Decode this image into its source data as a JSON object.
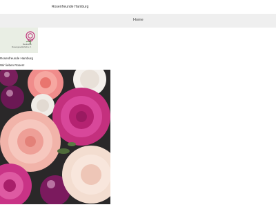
{
  "header": {
    "site_title": "Rosenfreunde Hamburg"
  },
  "nav": {
    "items": [
      {
        "label": "Home"
      }
    ]
  },
  "sidebar": {
    "logo_text_line1": "Deutsche",
    "logo_text_line2": "Rosengesellschaft e.V.",
    "name": "Rosenfreunde Hamburg",
    "tagline": "Wir lieben Rosen!"
  },
  "colors": {
    "nav_background": "#efefef",
    "logo_background": "#e9eee4",
    "logo_accent": "#c0307a"
  }
}
